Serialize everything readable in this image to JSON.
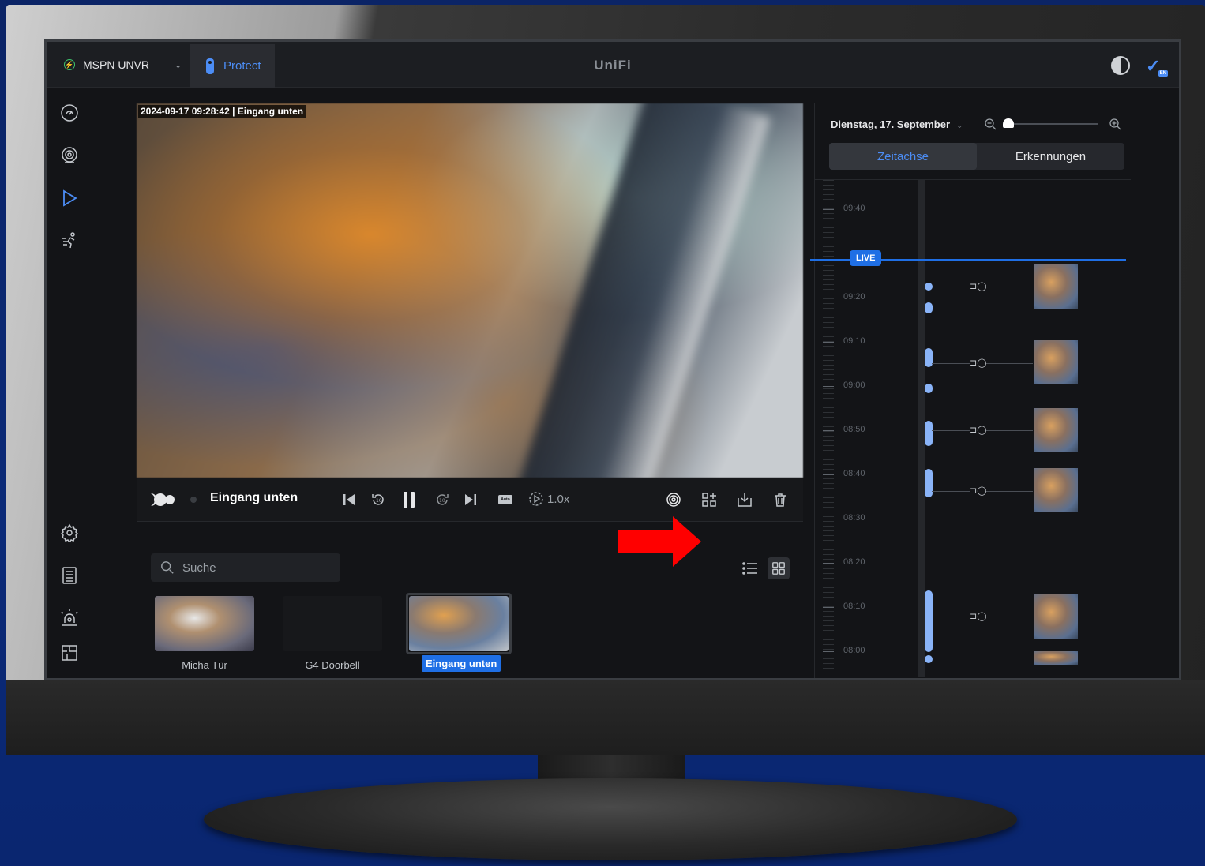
{
  "topbar": {
    "console_name": "MSPN UNVR",
    "app_name": "Protect",
    "brand": "UniFi",
    "user_lang_badge": "EN"
  },
  "leftnav": {
    "items": [
      "dashboard-icon",
      "cameras-icon",
      "play-icon",
      "motion-icon",
      "settings-icon",
      "logs-icon",
      "alarm-icon",
      "floorplan-icon"
    ]
  },
  "player": {
    "osd_timestamp": "2024-09-17 09:28:42 | Eingang unten",
    "camera_title": "Eingang unten",
    "auto_label": "Auto",
    "speed": "1.0x"
  },
  "browser": {
    "search_placeholder": "Suche",
    "cameras": [
      {
        "name": "Micha Tür"
      },
      {
        "name": "G4 Doorbell"
      },
      {
        "name": "Eingang unten",
        "selected": true
      }
    ]
  },
  "timeline": {
    "date": "Dienstag, 17. September",
    "tabs": [
      "Zeitachse",
      "Erkennungen"
    ],
    "active_tab": "Zeitachse",
    "live_label": "LIVE",
    "ticks": [
      "09:40",
      "09:20",
      "09:10",
      "09:00",
      "08:50",
      "08:40",
      "08:30",
      "08:20",
      "08:10",
      "08:00"
    ]
  },
  "colors": {
    "accent": "#4c8df5",
    "live": "#1f6fe5",
    "event_dot": "#8ab4f8",
    "annotation_arrow": "#ff0000"
  }
}
